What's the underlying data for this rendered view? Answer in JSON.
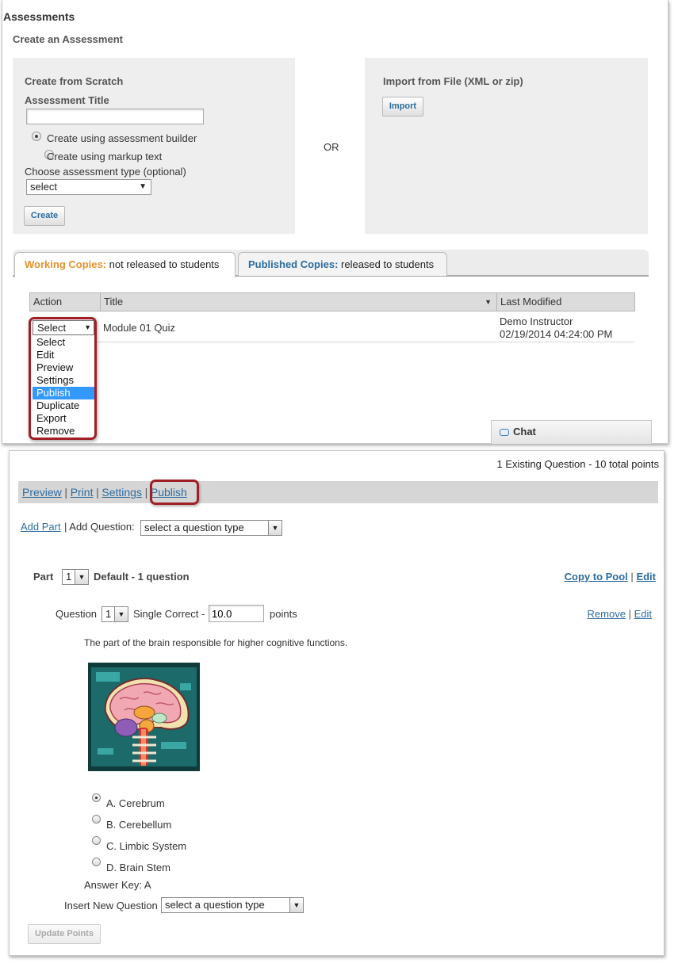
{
  "assessments": {
    "title": "Assessments",
    "subtitle": "Create an Assessment",
    "scratch": {
      "heading": "Create from Scratch",
      "title_label": "Assessment Title",
      "title_value": "",
      "option_builder": "Create using assessment builder",
      "option_markup": "Create using markup text",
      "type_label": "Choose assessment type (optional)",
      "type_selected": "select",
      "create_button": "Create"
    },
    "or_label": "OR",
    "import": {
      "heading": "Import from File (XML or zip)",
      "import_button": "Import"
    },
    "tabs": [
      {
        "strong": "Working Copies:",
        "rest": " not released to students"
      },
      {
        "strong": "Published Copies:",
        "rest": " released to students"
      }
    ],
    "table": {
      "headers": [
        "Action",
        "Title",
        "Last Modified"
      ],
      "row": {
        "action_selected": "Select",
        "title": "Module 01 Quiz",
        "modified_by": "Demo Instructor",
        "modified_date": "02/19/2014 04:24:00 PM"
      }
    },
    "action_options": [
      "Select",
      "Edit",
      "Preview",
      "Settings",
      "Publish",
      "Duplicate",
      "Export",
      "Remove"
    ],
    "chat_label": "Chat"
  },
  "editor": {
    "existing_count": "1 Existing Question - 10 total points",
    "toolbar": {
      "preview": "Preview",
      "print": "Print",
      "settings": "Settings",
      "publish": "Publish",
      "sep": "|"
    },
    "add_part": "Add Part",
    "add_question_label": "| Add Question:",
    "question_type_placeholder": "select a question type",
    "part": {
      "label": "Part",
      "number": "1",
      "desc": "Default - 1 question",
      "copy_to_pool": "Copy to Pool",
      "edit": "Edit"
    },
    "question": {
      "label": "Question",
      "number": "1",
      "type": "Single Correct -",
      "points_value": "10.0",
      "points_label": "points",
      "remove": "Remove",
      "edit": "Edit",
      "text": "The part of the brain responsible for higher cognitive functions.",
      "choices": [
        "A. Cerebrum",
        "B. Cerebellum",
        "C. Limbic System",
        "D. Brain Stem"
      ],
      "answer_key": "Answer Key: A"
    },
    "insert_label": "Insert New Question",
    "insert_placeholder": "select a question type",
    "update_button": "Update Points"
  }
}
